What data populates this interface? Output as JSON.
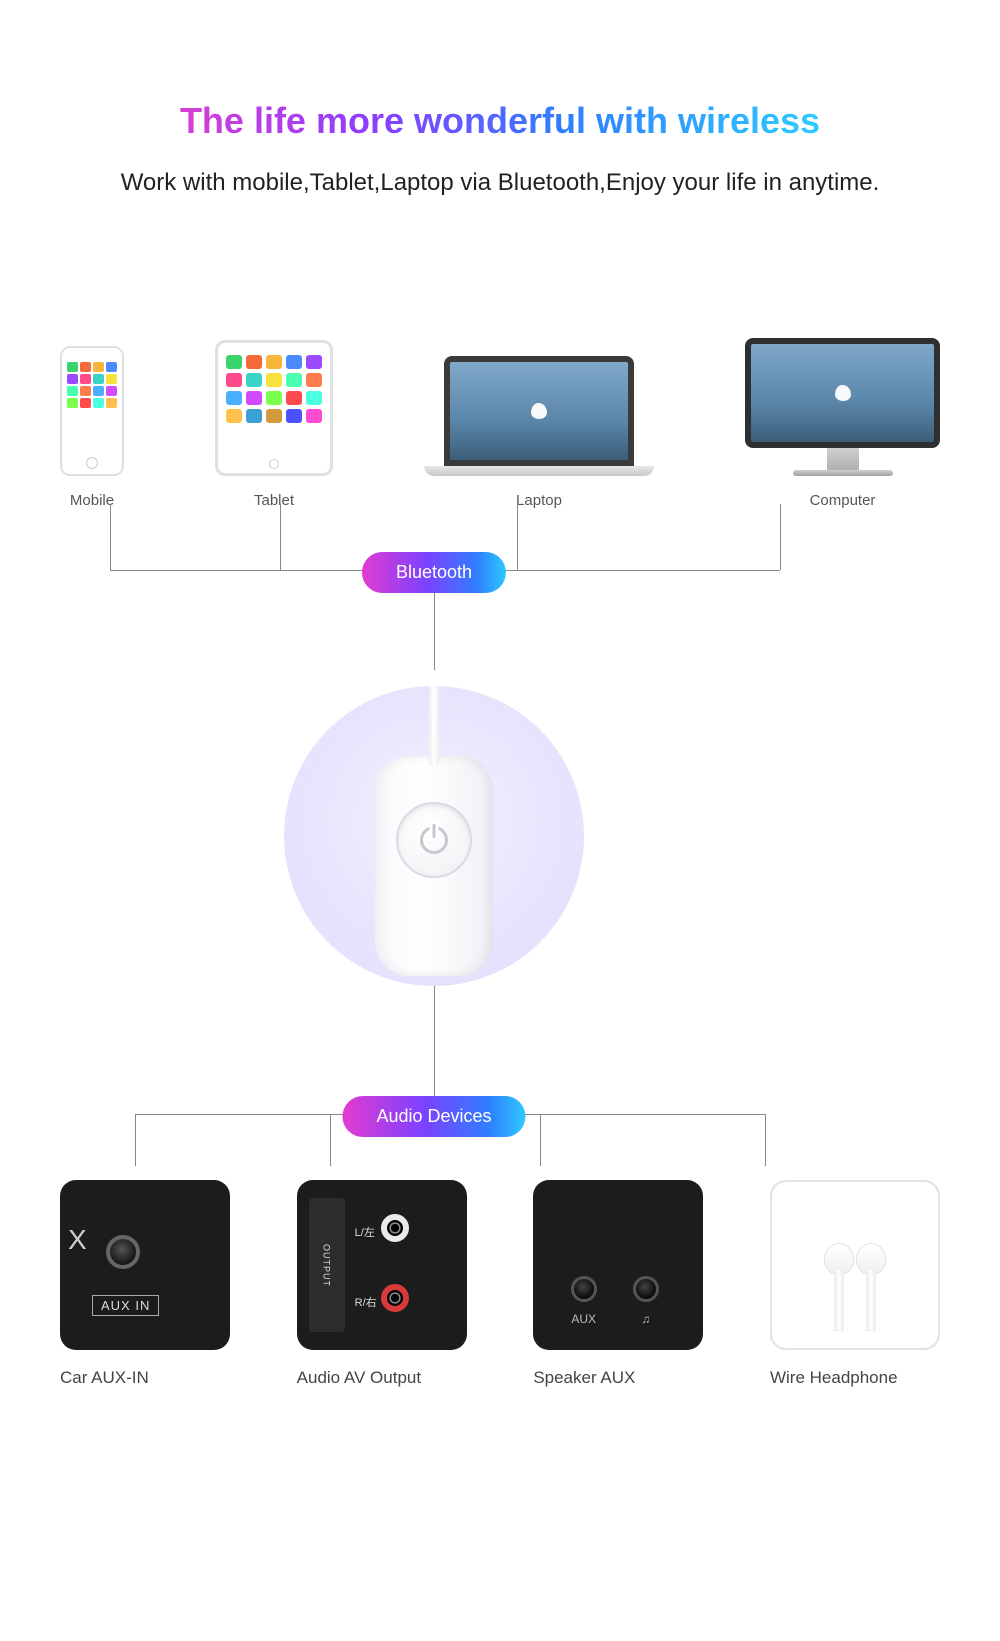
{
  "heading": {
    "title": "The life more wonderful with wireless",
    "subtitle": "Work with mobile,Tablet,Laptop via Bluetooth,Enjoy your life in anytime."
  },
  "top_devices": [
    {
      "label": "Mobile"
    },
    {
      "label": "Tablet"
    },
    {
      "label": "Laptop"
    },
    {
      "label": "Computer"
    }
  ],
  "pills": {
    "bluetooth": "Bluetooth",
    "audio": "Audio Devices"
  },
  "bottom_devices": [
    {
      "label": "Car AUX-IN",
      "aux_text": "AUX IN",
      "x": "X"
    },
    {
      "label": "Audio AV Output",
      "vert": "OUTPUT",
      "l": "L/左",
      "r": "R/右"
    },
    {
      "label": "Speaker AUX",
      "t1": "AUX",
      "t2": "♫"
    },
    {
      "label": "Wire Headphone"
    }
  ],
  "icon_colors": {
    "phone_apps": [
      "#3bd36b",
      "#f46b3b",
      "#f7b63b",
      "#4b8bff",
      "#9a4bff",
      "#ff4b8b",
      "#3bd3c8",
      "#f7e13b",
      "#4bffb1",
      "#ff7d4b",
      "#4bb1ff",
      "#d34bff",
      "#7aff4b",
      "#ff4b4b",
      "#4bffe1",
      "#ffc14b"
    ],
    "tablet_apps": [
      "#3bd36b",
      "#f46b3b",
      "#f7b63b",
      "#4b8bff",
      "#9a4bff",
      "#ff4b8b",
      "#3bd3c8",
      "#f7e13b",
      "#4bffb1",
      "#ff7d4b",
      "#4bb1ff",
      "#d34bff",
      "#7aff4b",
      "#ff4b4b",
      "#4bffe1",
      "#ffc14b",
      "#3ba0d3",
      "#d39a3b",
      "#4b52ff",
      "#ff4bcf"
    ]
  }
}
